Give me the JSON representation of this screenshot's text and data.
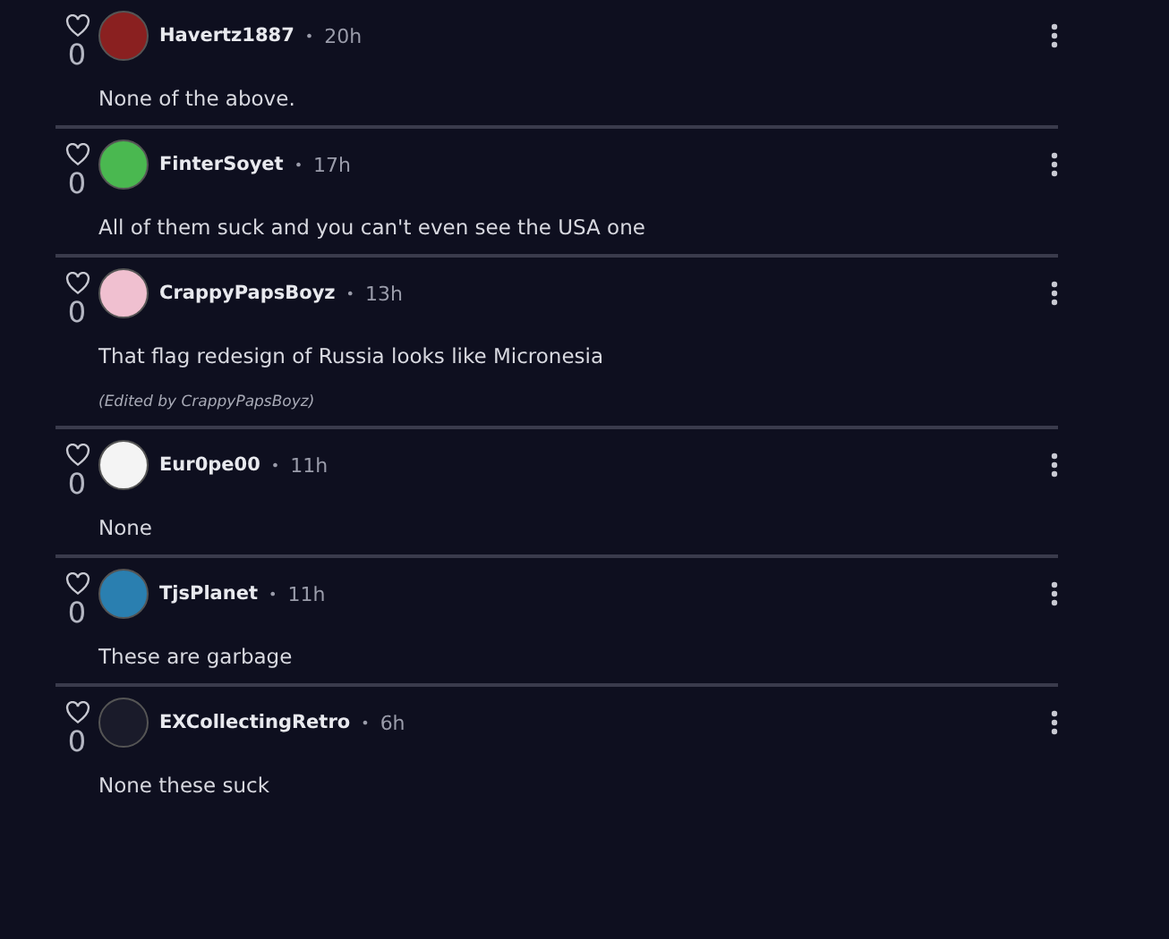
{
  "comments": [
    {
      "author": "Havertz1887",
      "time": "20h",
      "likes": "0",
      "liked": false,
      "text": "None of the above."
    },
    {
      "author": "FinterSoyet",
      "time": "17h",
      "likes": "0",
      "liked": false,
      "text": "All of them suck and you can't even see the USA one"
    },
    {
      "author": "CrappyPapsBoyz",
      "time": "13h",
      "likes": "0",
      "liked": false,
      "text": "That flag redesign of Russia looks like Micronesia",
      "edited_note": "(Edited by CrappyPapsBoyz)"
    },
    {
      "author": "Eur0pe00",
      "time": "11h",
      "likes": "0",
      "liked": false,
      "text": "None"
    },
    {
      "author": "TjsPlanet",
      "time": "11h",
      "likes": "0",
      "liked": false,
      "text": "These are garbage"
    },
    {
      "author": "EXCollectingRetro",
      "time": "6h",
      "likes": "0",
      "liked": false,
      "text": "None these suck"
    }
  ],
  "separator": "•"
}
